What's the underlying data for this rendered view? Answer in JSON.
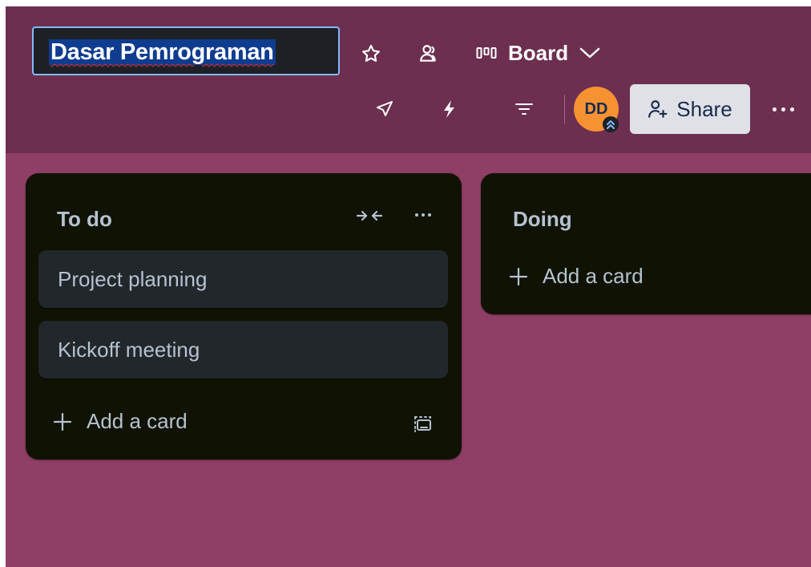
{
  "board": {
    "title": "Dasar Pemrograman",
    "view_label": "Board"
  },
  "header": {
    "icons": [
      "star-icon",
      "members-icon",
      "board-view-icon",
      "chevron-down-icon",
      "power-ups-icon",
      "automation-icon",
      "filter-icon",
      "more-icon"
    ],
    "avatar_initials": "DD",
    "share_label": "Share"
  },
  "lists": [
    {
      "title": "To do",
      "cards": [
        "Project planning",
        "Kickoff meeting"
      ],
      "add_card_label": "Add a card"
    },
    {
      "title": "Doing",
      "cards": [],
      "add_card_label": "Add a card"
    }
  ],
  "colors": {
    "header_bg": "#6c2f50",
    "board_bg": "#8f3f66",
    "list_bg": "#101204",
    "card_bg": "#22272b",
    "avatar_bg": "#f79232",
    "share_bg": "#dfe1e6",
    "selection": "#0f3c8f",
    "focus_ring": "#85b8ff"
  }
}
